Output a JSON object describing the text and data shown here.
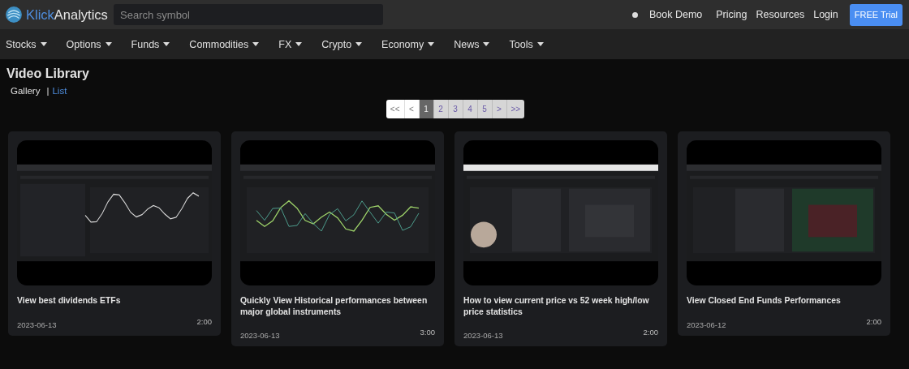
{
  "header": {
    "logo": {
      "part_1": "Klick",
      "part_2": "Analytics"
    },
    "search": {
      "placeholder": "Search symbol"
    },
    "links": [
      "Book Demo",
      "Pricing",
      "Resources",
      "Login"
    ],
    "cta": "FREE Trial"
  },
  "nav": [
    "Stocks",
    "Options",
    "Funds",
    "Commodities",
    "FX",
    "Crypto",
    "Economy",
    "News",
    "Tools"
  ],
  "page": {
    "title": "Video Library",
    "separator": "|",
    "views": [
      {
        "label": "Gallery",
        "selected": true
      },
      {
        "label": "List",
        "selected": false
      }
    ]
  },
  "pagination": [
    {
      "label": "<<",
      "selected": false,
      "disabled": true
    },
    {
      "label": "<",
      "selected": false,
      "disabled": true
    },
    {
      "label": "1",
      "selected": true,
      "disabled": false
    },
    {
      "label": "2",
      "selected": false,
      "disabled": false
    },
    {
      "label": "3",
      "selected": false,
      "disabled": false
    },
    {
      "label": "4",
      "selected": false,
      "disabled": false
    },
    {
      "label": "5",
      "selected": false,
      "disabled": false
    },
    {
      "label": ">",
      "selected": false,
      "disabled": false
    },
    {
      "label": ">>",
      "selected": false,
      "disabled": false
    }
  ],
  "videos": [
    {
      "title": "View best dividends ETFs",
      "date": "2023-06-13",
      "duration": "2:00"
    },
    {
      "title": "Quickly View Historical performances between major global instruments",
      "date": "2023-06-13",
      "duration": "3:00"
    },
    {
      "title": "How to view current price vs 52 week high/low price statistics",
      "date": "2023-06-13",
      "duration": "2:00"
    },
    {
      "title": "View Closed End Funds Performances",
      "date": "2023-06-12",
      "duration": "2:00"
    }
  ]
}
